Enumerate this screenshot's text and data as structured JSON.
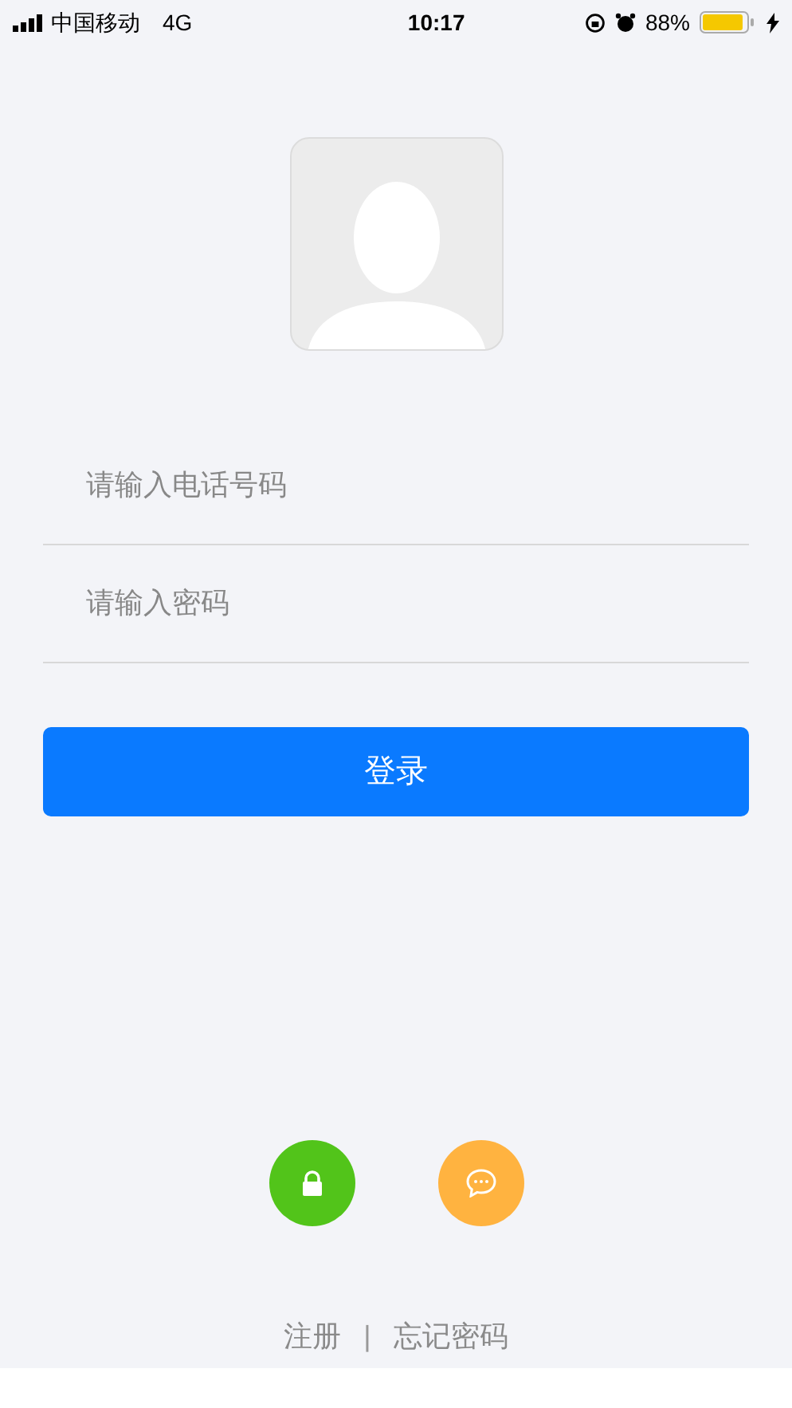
{
  "status_bar": {
    "carrier": "中国移动",
    "network": "4G",
    "time": "10:17",
    "battery": "88%"
  },
  "fields": [
    {
      "placeholder": "请输入电话号码"
    },
    {
      "placeholder": "请输入密码"
    }
  ],
  "login_button": "登录",
  "quick_login": [
    {
      "kind": "lock",
      "color": "#52c41a"
    },
    {
      "kind": "chat",
      "color": "#ffb340"
    }
  ],
  "links": {
    "register": "注册",
    "separator": "|",
    "forgot": "忘记密码"
  }
}
